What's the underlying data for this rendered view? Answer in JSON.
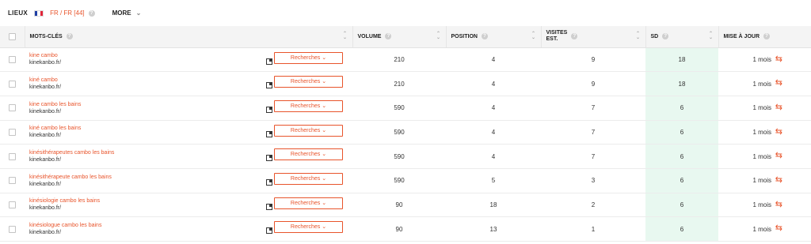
{
  "topbar": {
    "lieux_label": "LIEUX",
    "flag_colors": [
      "#1f3fa5",
      "#ffffff",
      "#e0263a"
    ],
    "location": "FR / FR [44]",
    "more_label": "MORE",
    "chevron_icon": "chevron-down-icon"
  },
  "columns": {
    "keywords": "MOTS-CLÉS",
    "volume": "VOLUME",
    "position": "POSITION",
    "visits_line1": "VISITES",
    "visits_line2": "EST.",
    "sd": "SD",
    "update": "MISE À JOUR"
  },
  "accent_color": "#e8542b",
  "sd_highlight_color": "#e8f8f0",
  "research_button_label": "Recherches ⌄",
  "rows": [
    {
      "keyword": "kine cambo",
      "url": "kinekanbo.fr/",
      "volume": "210",
      "position": "4",
      "visits": "9",
      "sd": "18",
      "update": "1 mois"
    },
    {
      "keyword": "kiné cambo",
      "url": "kinekanbo.fr/",
      "volume": "210",
      "position": "4",
      "visits": "9",
      "sd": "18",
      "update": "1 mois"
    },
    {
      "keyword": "kine cambo les bains",
      "url": "kinekanbo.fr/",
      "volume": "590",
      "position": "4",
      "visits": "7",
      "sd": "6",
      "update": "1 mois"
    },
    {
      "keyword": "kiné cambo les bains",
      "url": "kinekanbo.fr/",
      "volume": "590",
      "position": "4",
      "visits": "7",
      "sd": "6",
      "update": "1 mois"
    },
    {
      "keyword": "kinésithérapeutes cambo les bains",
      "url": "kinekanbo.fr/",
      "volume": "590",
      "position": "4",
      "visits": "7",
      "sd": "6",
      "update": "1 mois"
    },
    {
      "keyword": "kinésithérapeute cambo les bains",
      "url": "kinekanbo.fr/",
      "volume": "590",
      "position": "5",
      "visits": "3",
      "sd": "6",
      "update": "1 mois"
    },
    {
      "keyword": "kinésiologie cambo les bains",
      "url": "kinekanbo.fr/",
      "volume": "90",
      "position": "18",
      "visits": "2",
      "sd": "6",
      "update": "1 mois"
    },
    {
      "keyword": "kinésiologue cambo les bains",
      "url": "kinekanbo.fr/",
      "volume": "90",
      "position": "13",
      "visits": "1",
      "sd": "6",
      "update": "1 mois"
    }
  ]
}
